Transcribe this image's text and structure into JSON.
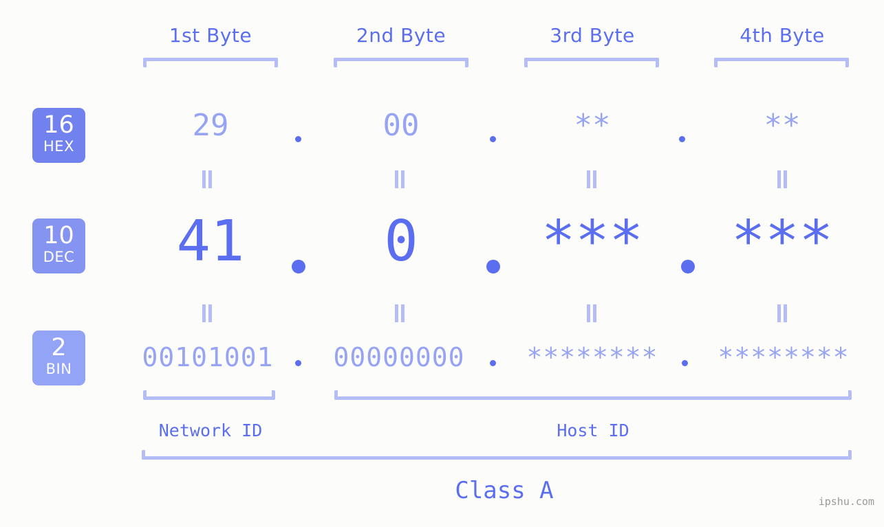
{
  "page": {
    "background_color": "#fcfdfa",
    "accent_color": "#5b6ef0",
    "accent_light_color": "#97a4f4",
    "bracket_color": "#b5bdf8",
    "watermark": "ipshu.com"
  },
  "byte_headers": [
    {
      "label": "1st Byte"
    },
    {
      "label": "2nd Byte"
    },
    {
      "label": "3rd Byte"
    },
    {
      "label": "4th Byte"
    }
  ],
  "bases": [
    {
      "num": "16",
      "abbr": "HEX",
      "color": "#7181ee"
    },
    {
      "num": "10",
      "abbr": "DEC",
      "color": "#8694f1"
    },
    {
      "num": "2",
      "abbr": "BIN",
      "color": "#93a3f5"
    }
  ],
  "rows": {
    "hex": {
      "base_num": "16",
      "base_abbr": "HEX",
      "values": [
        "29",
        "00",
        "**",
        "**"
      ],
      "separator": "."
    },
    "dec": {
      "base_num": "10",
      "base_abbr": "DEC",
      "values": [
        "41",
        "0",
        "***",
        "***"
      ],
      "separator": "."
    },
    "bin": {
      "base_num": "2",
      "base_abbr": "BIN",
      "values": [
        "00101001",
        "00000000",
        "********",
        "********"
      ],
      "separator": "."
    }
  },
  "equal_markers": {
    "glyph": "=",
    "count": 8
  },
  "segments": {
    "network_id": {
      "label": "Network ID"
    },
    "host_id": {
      "label": "Host ID"
    },
    "class": {
      "label": "Class A"
    }
  }
}
